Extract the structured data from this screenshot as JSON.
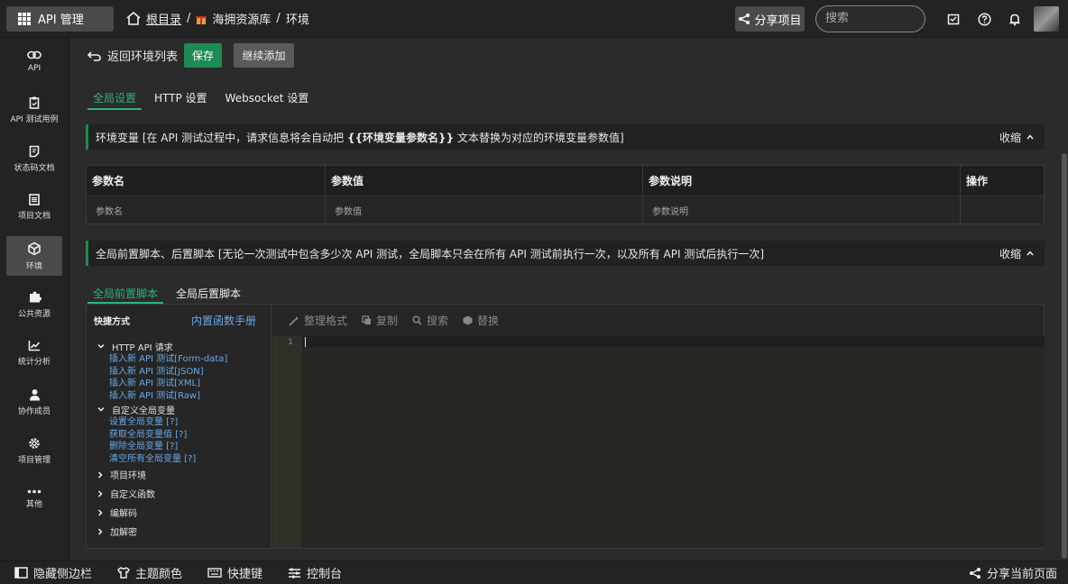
{
  "topbar": {
    "app_label": "API 管理",
    "breadcrumb": {
      "root": "根目录",
      "sep": "/",
      "project": "海拥资源库",
      "page": "环境"
    },
    "share_label": "分享项目",
    "search_placeholder": "搜索"
  },
  "sidebar": {
    "items": [
      {
        "label": "API",
        "icon": "link-icon"
      },
      {
        "label": "API 测试用例",
        "icon": "clipboard-icon"
      },
      {
        "label": "状态码文档",
        "icon": "doc-icon"
      },
      {
        "label": "项目文档",
        "icon": "list-icon"
      },
      {
        "label": "环境",
        "icon": "cube-icon",
        "active": true
      },
      {
        "label": "公共资源",
        "icon": "puzzle-icon"
      },
      {
        "label": "统计分析",
        "icon": "chart-icon"
      },
      {
        "label": "协作成员",
        "icon": "user-icon"
      },
      {
        "label": "项目管理",
        "icon": "gear-icon"
      },
      {
        "label": "其他",
        "icon": "more-icon"
      }
    ]
  },
  "actions": {
    "back_label": "返回环境列表",
    "save_label": "保存",
    "add_label": "继续添加"
  },
  "tabs": [
    "全局设置",
    "HTTP 设置",
    "Websocket 设置"
  ],
  "env_section": {
    "text_pre": "环境变量 [在 API 测试过程中，请求信息将会自动把 ",
    "text_bold": "{{环境变量参数名}}",
    "text_post": " 文本替换为对应的环境变量参数值]",
    "collapse_label": "收缩"
  },
  "env_table": {
    "headers": [
      "参数名",
      "参数值",
      "参数说明",
      "操作"
    ],
    "placeholders": [
      "参数名",
      "参数值",
      "参数说明",
      ""
    ]
  },
  "script_section": {
    "text": "全局前置脚本、后置脚本 [无论一次测试中包含多少次 API 测试，全局脚本只会在所有 API 测试前执行一次，以及所有 API 测试后执行一次]",
    "collapse_label": "收缩"
  },
  "script_tabs": [
    "全局前置脚本",
    "全局后置脚本"
  ],
  "shortcuts": {
    "title": "快捷方式",
    "manual_link": "内置函数手册",
    "groups": [
      {
        "label": "HTTP API 请求",
        "expanded": true,
        "links": [
          "插入新 API 测试[Form-data]",
          "插入新 API 测试[JSON]",
          "插入新 API 测试[XML]",
          "插入新 API 测试[Raw]"
        ]
      },
      {
        "label": "自定义全局变量",
        "expanded": true,
        "links": [
          "设置全局变量 [?]",
          "获取全局变量值 [?]",
          "删除全局变量 [?]",
          "清空所有全局变量 [?]"
        ]
      },
      {
        "label": "项目环境",
        "expanded": false,
        "links": []
      },
      {
        "label": "自定义函数",
        "expanded": false,
        "links": []
      },
      {
        "label": "编解码",
        "expanded": false,
        "links": []
      },
      {
        "label": "加解密",
        "expanded": false,
        "links": []
      }
    ]
  },
  "editor_toolbar": [
    "整理格式",
    "复制",
    "搜索",
    "替换"
  ],
  "editor": {
    "line_number": "1"
  },
  "footer": {
    "items": [
      "隐藏侧边栏",
      "主题颜色",
      "快捷键",
      "控制台"
    ],
    "share_page": "分享当前页面"
  }
}
